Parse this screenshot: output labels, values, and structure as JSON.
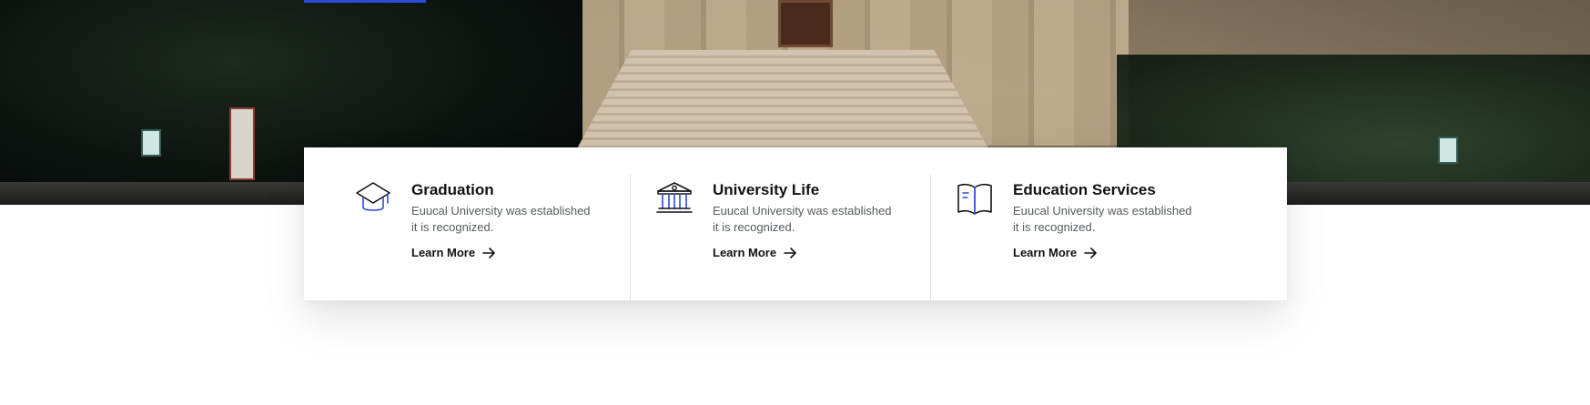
{
  "hero": {
    "accent_color": "#2d4bd6"
  },
  "features": [
    {
      "icon": "graduation-cap-icon",
      "title": "Graduation",
      "description": "Euucal University was established it is recognized.",
      "link_label": "Learn More"
    },
    {
      "icon": "university-building-icon",
      "title": "University Life",
      "description": "Euucal University was established it is recognized.",
      "link_label": "Learn More"
    },
    {
      "icon": "open-book-icon",
      "title": "Education Services",
      "description": "Euucal University was established it is recognized.",
      "link_label": "Learn More"
    }
  ],
  "colors": {
    "text": "#111216",
    "muted": "#555a60",
    "icon_accent": "#2d4bd6"
  }
}
